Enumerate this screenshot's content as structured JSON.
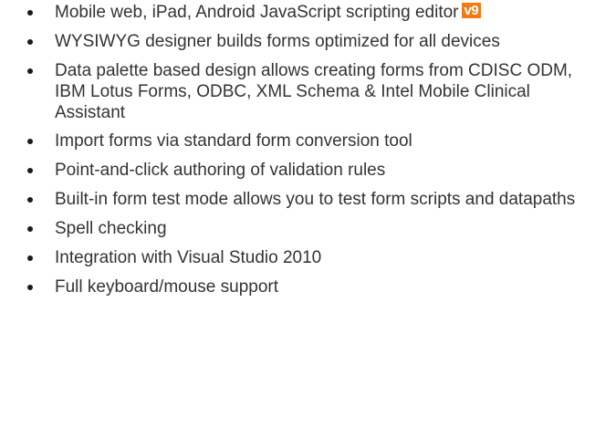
{
  "features": [
    {
      "text": "Mobile web, iPad, Android JavaScript scripting editor",
      "badge": "v9"
    },
    {
      "text": "WYSIWYG designer builds forms optimized for all devices"
    },
    {
      "text": "Data palette based design allows creating forms from CDISC ODM, IBM Lotus Forms, ODBC, XML Schema & Intel Mobile Clinical Assistant"
    },
    {
      "text": "Import forms via standard form conversion tool"
    },
    {
      "text": "Point-and-click authoring of validation rules"
    },
    {
      "text": "Built-in form test mode allows you to test form scripts and datapaths"
    },
    {
      "text": "Spell checking"
    },
    {
      "text": "Integration with Visual Studio 2010"
    },
    {
      "text": "Full keyboard/mouse support"
    }
  ],
  "colors": {
    "text": "#333333",
    "bullet": "#1a1a1a",
    "badge_bg": "#f27a10",
    "badge_text": "#ffffff"
  }
}
